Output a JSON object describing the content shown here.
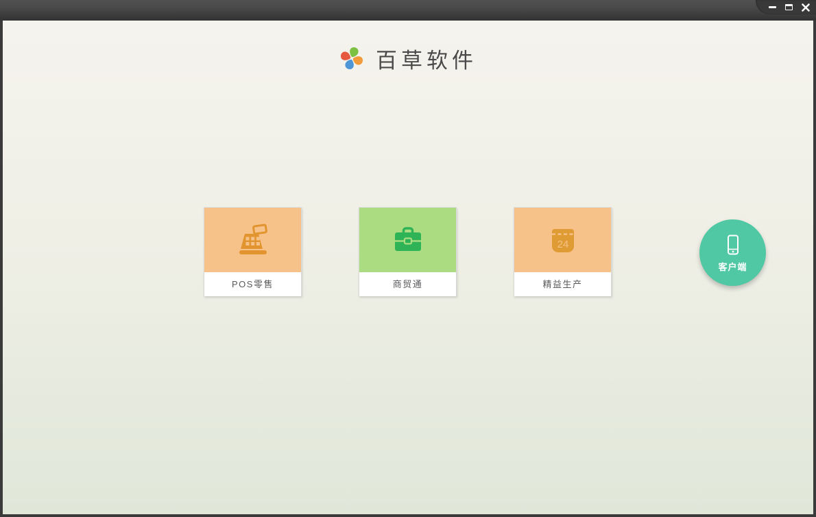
{
  "window": {
    "controls": [
      {
        "name": "minimize",
        "icon": "minimize-icon"
      },
      {
        "name": "maximize",
        "icon": "maximize-icon"
      },
      {
        "name": "close",
        "icon": "close-icon"
      }
    ]
  },
  "brand": {
    "title": "百草软件",
    "logo_icon": "pinwheel-logo-icon",
    "logo_colors": {
      "top": "#7cc142",
      "right": "#f29b3b",
      "bottom": "#4f96d9",
      "left": "#e4593f"
    }
  },
  "products": [
    {
      "label": "POS零售",
      "icon": "cash-register-icon",
      "tile_color": "#f6c28a",
      "icon_color": "#e2952f"
    },
    {
      "label": "商贸通",
      "icon": "briefcase-icon",
      "tile_color": "#abdc81",
      "icon_color": "#2eb457"
    },
    {
      "label": "精益生产",
      "icon": "calendar-icon",
      "tile_color": "#f6c28a",
      "icon_color": "#df9c35",
      "calendar_day": "24"
    }
  ],
  "client_button": {
    "label": "客户端",
    "icon": "smartphone-icon",
    "color": "#50c8a3"
  },
  "theme": {
    "titlebar_top": "#515151",
    "titlebar_bottom": "#323232",
    "content_top": "#f5f3ed",
    "content_bottom": "#e0e7d9",
    "card_label_color": "#58595b",
    "title_text_color": "#4a4a4a"
  }
}
